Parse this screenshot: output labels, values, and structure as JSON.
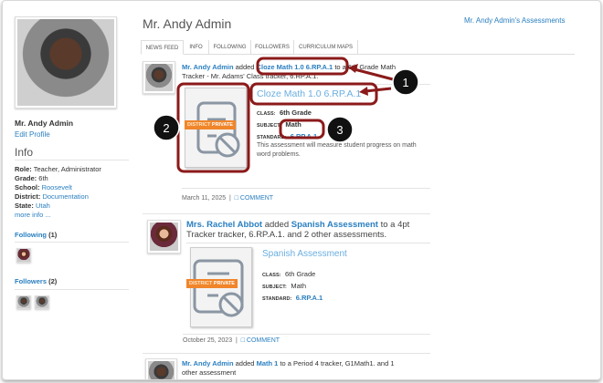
{
  "profile": {
    "name": "Mr. Andy Admin",
    "edit_link": "Edit Profile",
    "info_heading": "Info",
    "info": [
      {
        "label": "Role:",
        "value": "Teacher, Administrator",
        "link": false
      },
      {
        "label": "Grade:",
        "value": "6th",
        "link": false
      },
      {
        "label": "School:",
        "value": "Roosevelt",
        "link": true
      },
      {
        "label": "District:",
        "value": "Documentation",
        "link": true
      },
      {
        "label": "State:",
        "value": "Utah",
        "link": true
      }
    ],
    "more_info": "more info ...",
    "following_label": "Following",
    "following_count": "(1)",
    "followers_label": "Followers",
    "followers_count": "(2)"
  },
  "header": {
    "title": "Mr. Andy Admin",
    "assessments_link": "Mr. Andy Admin's Assessments"
  },
  "tabs": [
    {
      "label": "NEWS FEED",
      "active": true
    },
    {
      "label": "INFO"
    },
    {
      "label": "FOLLOWING"
    },
    {
      "label": "FOLLOWERS"
    },
    {
      "label": "CURRICULUM MAPS"
    }
  ],
  "feed": [
    {
      "actor": "Mr. Andy Admin",
      "verb": "added",
      "item": "Cloze Math 1.0 6.RP.A.1",
      "rest": "to a 6th Grade Math",
      "line2": "Tracker - Mr. Adams' Class tracker, 6.RP.A.1.",
      "badge_a": "DISTRICT",
      "badge_b": "PRIVATE",
      "title": "Cloze Math 1.0 6.RP.A.1",
      "class_label": "Class:",
      "class": "6th Grade",
      "subject_label": "Subject:",
      "subject": "Math",
      "standard_label": "Standard:",
      "standard": "6.RP.A.1",
      "description": "This assessment will measure student progress on math",
      "description2": "word problems.",
      "date": "March 11, 2025",
      "comment": "COMMENT"
    },
    {
      "actor": "Mrs. Rachel Abbot",
      "verb": "added",
      "item": "Spanish Assessment",
      "rest": "to a 4pt",
      "line2": "Tracker tracker, 6.RP.A.1. and 2 other assessments.",
      "badge_a": "DISTRICT",
      "badge_b": "PRIVATE",
      "title": "Spanish Assessment",
      "class_label": "Class:",
      "class": "6th Grade",
      "subject_label": "Subject:",
      "subject": "Math",
      "standard_label": "Standard:",
      "standard": "6.RP.A.1",
      "date": "October 25, 2023",
      "comment": "COMMENT"
    },
    {
      "actor": "Mr. Andy Admin",
      "verb": "added",
      "item": "Math 1",
      "rest": "to a Period 4 tracker, G1Math1. and 1",
      "line2": "other assessment"
    }
  ],
  "separator": "|",
  "annotations": {
    "one": "1",
    "two": "2",
    "three": "3",
    "color": "#8b1a1a"
  }
}
